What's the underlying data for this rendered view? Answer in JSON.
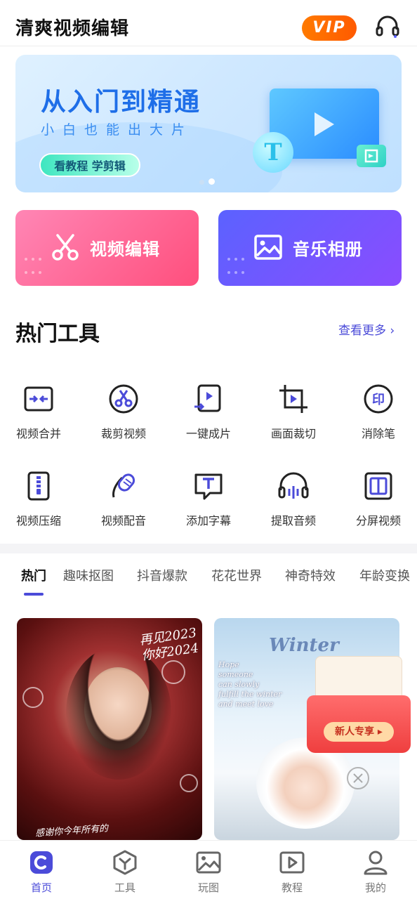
{
  "header": {
    "title": "清爽视频编辑",
    "vip_label": "VIP",
    "support_icon": "headset-icon"
  },
  "banner": {
    "title": "从入门到精通",
    "subtitle": "小白也能出大片",
    "button_label": "看教程 学剪辑",
    "slide_index": 2,
    "slide_count": 2
  },
  "actions": {
    "video_edit": {
      "label": "视频编辑",
      "icon": "scissors-icon",
      "color": "#ff5b86"
    },
    "music_album": {
      "label": "音乐相册",
      "icon": "image-icon",
      "color": "#6a57ff"
    }
  },
  "hot_tools": {
    "title": "热门工具",
    "more_label": "查看更多",
    "items": [
      {
        "label": "视频合并",
        "icon": "merge-icon"
      },
      {
        "label": "裁剪视频",
        "icon": "cut-video-icon"
      },
      {
        "label": "一键成片",
        "icon": "one-click-video-icon"
      },
      {
        "label": "画面裁切",
        "icon": "crop-icon"
      },
      {
        "label": "消除笔",
        "icon": "eraser-icon"
      },
      {
        "label": "视频压缩",
        "icon": "compress-icon"
      },
      {
        "label": "视频配音",
        "icon": "voiceover-icon"
      },
      {
        "label": "添加字幕",
        "icon": "subtitle-icon"
      },
      {
        "label": "提取音频",
        "icon": "extract-audio-icon"
      },
      {
        "label": "分屏视频",
        "icon": "split-screen-icon"
      }
    ]
  },
  "category_tabs": {
    "items": [
      "热门",
      "趣味抠图",
      "抖音爆款",
      "花花世界",
      "神奇特效",
      "年龄变换"
    ],
    "active_index": 0
  },
  "feed": {
    "card1": {
      "handwriting_top": "再见2023\n你好2024",
      "handwriting_bottom": "感谢你今年所有的"
    },
    "card2": {
      "title_text": "Winter",
      "handwriting": "Hope\nsomeone\ncan slowly\nfulfill the winter\nand meet love"
    }
  },
  "promo": {
    "envelope_button": "新人专享 ▸"
  },
  "bottom_nav": {
    "items": [
      {
        "label": "首页",
        "icon": "home-icon"
      },
      {
        "label": "工具",
        "icon": "tools-icon"
      },
      {
        "label": "玩图",
        "icon": "photo-icon"
      },
      {
        "label": "教程",
        "icon": "tutorial-icon"
      },
      {
        "label": "我的",
        "icon": "profile-icon"
      }
    ],
    "active_index": 0
  },
  "colors": {
    "accent": "#4b4bd9",
    "vip_orange": "#ff6a00",
    "banner_blue": "#1e6ee8"
  }
}
